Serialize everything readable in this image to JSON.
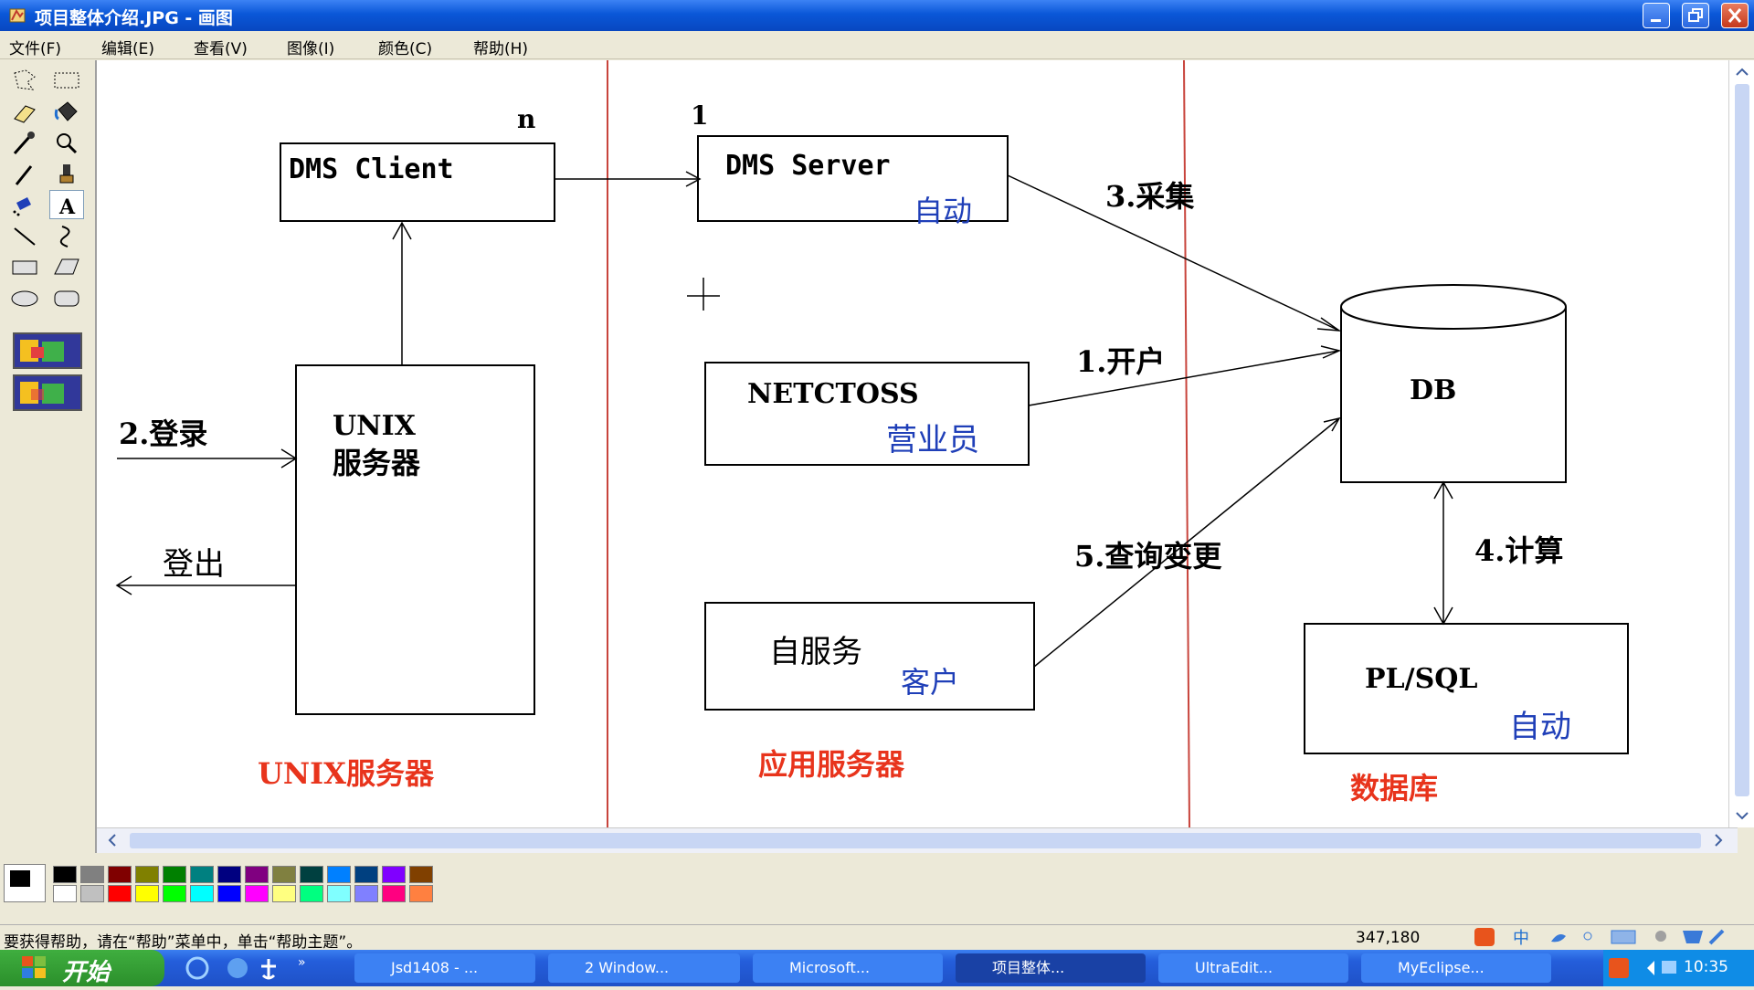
{
  "window": {
    "title": "项目整体介绍.JPG - 画图"
  },
  "menu": [
    "文件(F)",
    "编辑(E)",
    "查看(V)",
    "图像(I)",
    "颜色(C)",
    "帮助(H)"
  ],
  "tools": [
    "free-select",
    "rect-select",
    "eraser",
    "fill",
    "picker",
    "magnifier",
    "pencil",
    "brush",
    "airbrush",
    "text",
    "line",
    "curve",
    "rectangle",
    "polygon",
    "ellipse",
    "rounded-rectangle"
  ],
  "diagram": {
    "dms_client": "DMS Client",
    "n_label": "n",
    "one_label": "1",
    "dms_server": "DMS Server",
    "dms_server_sub": "自动",
    "collect": "3.采集",
    "open_account": "1.开户",
    "netctoss": "NETCTOSS",
    "netctoss_sub": "营业员",
    "db": "DB",
    "unix_line1": "UNIX",
    "unix_line2": "服务器",
    "login": "2.登录",
    "logout": "登出",
    "query_change": "5.查询变更",
    "compute": "4.计算",
    "self_service": "自服务",
    "self_service_sub": "客户",
    "plsql": "PL/SQL",
    "plsql_sub": "自动",
    "zone_unix": "UNIX服务器",
    "zone_app": "应用服务器",
    "zone_db": "数据库"
  },
  "colors": {
    "red": "#e8341c",
    "blue": "#1f3fb8",
    "zone_line": "#c8443c"
  },
  "palette": [
    "#000000",
    "#808080",
    "#800000",
    "#808000",
    "#008000",
    "#008080",
    "#000080",
    "#800080",
    "#808040",
    "#004040",
    "#0080ff",
    "#004080",
    "#8000ff",
    "#804000",
    "#ffffff",
    "#c0c0c0",
    "#ff0000",
    "#ffff00",
    "#00ff00",
    "#00ffff",
    "#0000ff",
    "#ff00ff",
    "#ffff80",
    "#00ff80",
    "#80ffff",
    "#8080ff",
    "#ff0080",
    "#ff8040"
  ],
  "status": {
    "help": "要获得帮助，请在“帮助”菜单中，单击“帮助主题”。",
    "coords": "347,180"
  },
  "taskbar": {
    "start": "开始",
    "tasks": [
      "Jsd1408 - ...",
      "2 Window...",
      "Microsoft...",
      "项目整体...",
      "UltraEdit...",
      "MyEclipse..."
    ],
    "clock": "10:35"
  }
}
